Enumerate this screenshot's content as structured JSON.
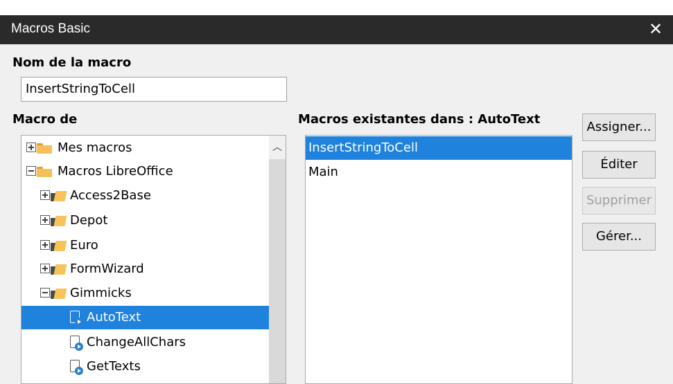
{
  "window": {
    "title": "Macros Basic"
  },
  "macro_name": {
    "label": "Nom de la macro",
    "value": "InsertStringToCell"
  },
  "macro_from": {
    "label": "Macro de",
    "tree": [
      {
        "label": "Mes macros",
        "level": 0,
        "type": "folder",
        "expanded": false,
        "selected": false
      },
      {
        "label": "Macros LibreOffice",
        "level": 0,
        "type": "folder",
        "expanded": true,
        "selected": false
      },
      {
        "label": "Access2Base",
        "level": 1,
        "type": "library",
        "expanded": false,
        "selected": false
      },
      {
        "label": "Depot",
        "level": 1,
        "type": "library",
        "expanded": false,
        "selected": false
      },
      {
        "label": "Euro",
        "level": 1,
        "type": "library",
        "expanded": false,
        "selected": false
      },
      {
        "label": "FormWizard",
        "level": 1,
        "type": "library",
        "expanded": false,
        "selected": false
      },
      {
        "label": "Gimmicks",
        "level": 1,
        "type": "library",
        "expanded": true,
        "selected": false
      },
      {
        "label": "AutoText",
        "level": 2,
        "type": "module",
        "selected": true
      },
      {
        "label": "ChangeAllChars",
        "level": 2,
        "type": "module",
        "selected": false
      },
      {
        "label": "GetTexts",
        "level": 2,
        "type": "module",
        "selected": false
      }
    ]
  },
  "existing_macros": {
    "label": "Macros existantes dans : AutoText",
    "items": [
      {
        "label": "InsertStringToCell",
        "selected": true
      },
      {
        "label": "Main",
        "selected": false
      }
    ]
  },
  "buttons": {
    "assign": "Assigner...",
    "edit": "Éditer",
    "delete": "Supprimer",
    "manage": "Gérer..."
  },
  "colors": {
    "selection": "#1f82dd",
    "titlebar": "#2a2a2a"
  }
}
